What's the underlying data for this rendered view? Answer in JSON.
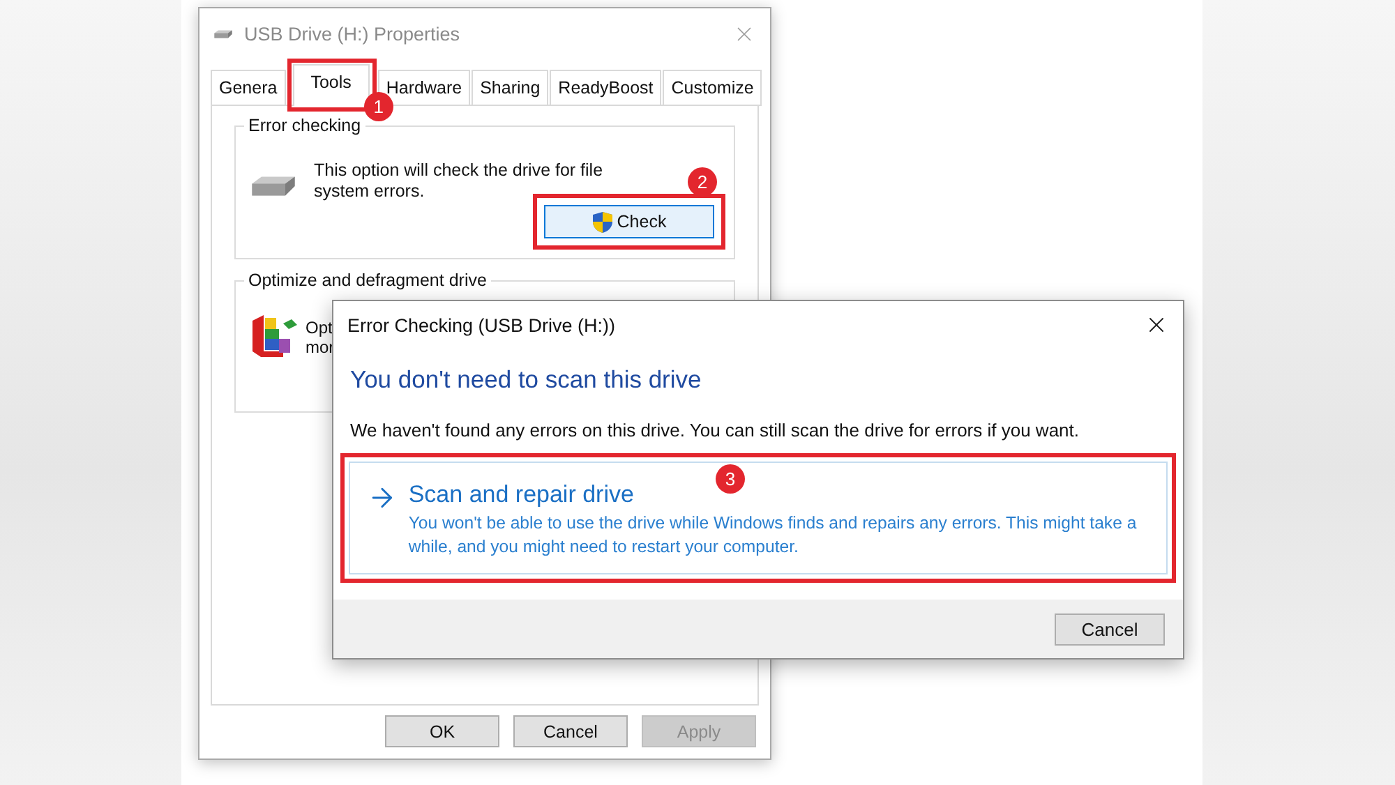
{
  "properties_window": {
    "title": "USB Drive (H:) Properties",
    "tabs": [
      {
        "label": "Genera",
        "selected": false
      },
      {
        "label": "Tools",
        "selected": true
      },
      {
        "label": "Hardware",
        "selected": false
      },
      {
        "label": "Sharing",
        "selected": false
      },
      {
        "label": "ReadyBoost",
        "selected": false
      },
      {
        "label": "Customize",
        "selected": false
      }
    ],
    "error_checking": {
      "title": "Error checking",
      "description": "This option will check the drive for file system errors.",
      "button": "Check"
    },
    "optimize": {
      "title": "Optimize and defragment drive",
      "description_lines": [
        "Opt",
        "mor"
      ]
    },
    "buttons": [
      {
        "label": "OK",
        "disabled": false
      },
      {
        "label": "Cancel",
        "disabled": false
      },
      {
        "label": "Apply",
        "disabled": true
      }
    ]
  },
  "error_dialog": {
    "title": "Error Checking (USB Drive (H:))",
    "heading": "You don't need to scan this drive",
    "message": "We haven't found any errors on this drive. You can still scan the drive for errors if you want.",
    "command_link": {
      "title": "Scan and repair drive",
      "description": "You won't be able to use the drive while Windows finds and repairs any errors. This might take a while, and you might need to restart your computer."
    },
    "buttons": [
      "Cancel"
    ]
  },
  "annotations": [
    {
      "label": "1"
    },
    {
      "label": "2"
    },
    {
      "label": "3"
    }
  ]
}
